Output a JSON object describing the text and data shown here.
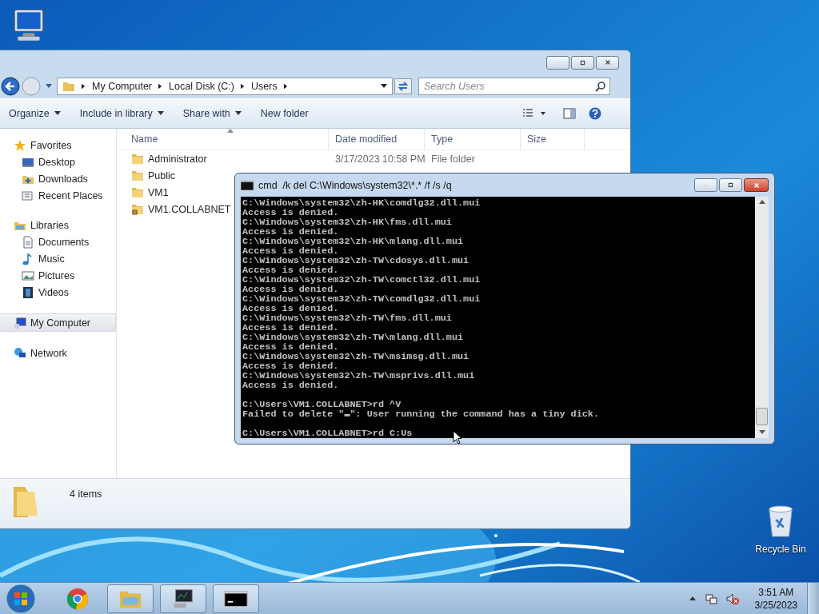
{
  "explorer": {
    "breadcrumb": [
      "My Computer",
      "Local Disk (C:)",
      "Users"
    ],
    "search": {
      "placeholder": "Search Users"
    },
    "toolbar": [
      {
        "label": "Organize",
        "dropdown": true
      },
      {
        "label": "Include in library",
        "dropdown": true
      },
      {
        "label": "Share with",
        "dropdown": true
      },
      {
        "label": "New folder",
        "dropdown": false
      }
    ],
    "sidebar": [
      {
        "label": "Favorites",
        "kind": "star",
        "selected": false,
        "children": [
          {
            "label": "Desktop",
            "kind": "desktop",
            "selected": false
          },
          {
            "label": "Downloads",
            "kind": "downloads",
            "selected": false
          },
          {
            "label": "Recent Places",
            "kind": "recent",
            "selected": false
          }
        ]
      },
      {
        "label": "Libraries",
        "kind": "library",
        "selected": false,
        "children": [
          {
            "label": "Documents",
            "kind": "document",
            "selected": false
          },
          {
            "label": "Music",
            "kind": "music",
            "selected": false
          },
          {
            "label": "Pictures",
            "kind": "pictures",
            "selected": false
          },
          {
            "label": "Videos",
            "kind": "video",
            "selected": false
          }
        ]
      },
      {
        "label": "My Computer",
        "kind": "computer",
        "selected": true
      },
      {
        "label": "Network",
        "kind": "network",
        "selected": false
      }
    ],
    "columns": [
      "Name",
      "Date modified",
      "Type",
      "Size"
    ],
    "rows": [
      {
        "name": "Administrator",
        "date": "3/17/2023 10:58 PM",
        "type": "File folder",
        "locked": false
      },
      {
        "name": "Public",
        "locked": false
      },
      {
        "name": "VM1",
        "locked": false
      },
      {
        "name": "VM1.COLLABNET",
        "locked": true
      }
    ],
    "status": "4 items"
  },
  "console": {
    "title": "cmd  /k del C:\\Windows\\system32\\*.* /f /s /q",
    "blocks": [
      [
        "C:\\Windows\\system32\\zh-HK\\comdlg32.dll.mui",
        "Access is denied.",
        "C:\\Windows\\system32\\zh-HK\\fms.dll.mui",
        "Access is denied.",
        "C:\\Windows\\system32\\zh-HK\\mlang.dll.mui",
        "Access is denied.",
        "C:\\Windows\\system32\\zh-TW\\cdosys.dll.mui",
        "Access is denied.",
        "C:\\Windows\\system32\\zh-TW\\comctl32.dll.mui",
        "Access is denied.",
        "C:\\Windows\\system32\\zh-TW\\comdlg32.dll.mui",
        "Access is denied.",
        "C:\\Windows\\system32\\zh-TW\\fms.dll.mui",
        "Access is denied.",
        "C:\\Windows\\system32\\zh-TW\\mlang.dll.mui",
        "Access is denied.",
        "C:\\Windows\\system32\\zh-TW\\msimsg.dll.mui",
        "Access is denied.",
        "C:\\Windows\\system32\\zh-TW\\msprivs.dll.mui",
        "Access is denied."
      ],
      [
        "C:\\Users\\VM1.COLLABNET>rd ^V",
        "Failed to delete \"▬\": User running the command has a tiny dick."
      ],
      [
        "C:\\Users\\VM1.COLLABNET>rd C:Us"
      ]
    ]
  },
  "desktop_icons": [
    {
      "kind": "recycle",
      "label": "Recycle Bin"
    }
  ],
  "taskbar": {
    "apps": [
      {
        "kind": "chrome",
        "selected": false
      },
      {
        "kind": "explorer",
        "selected": true
      },
      {
        "kind": "monitor",
        "selected": true
      },
      {
        "kind": "console",
        "selected": true
      }
    ],
    "time": "3:51 AM",
    "date": "3/25/2023"
  }
}
